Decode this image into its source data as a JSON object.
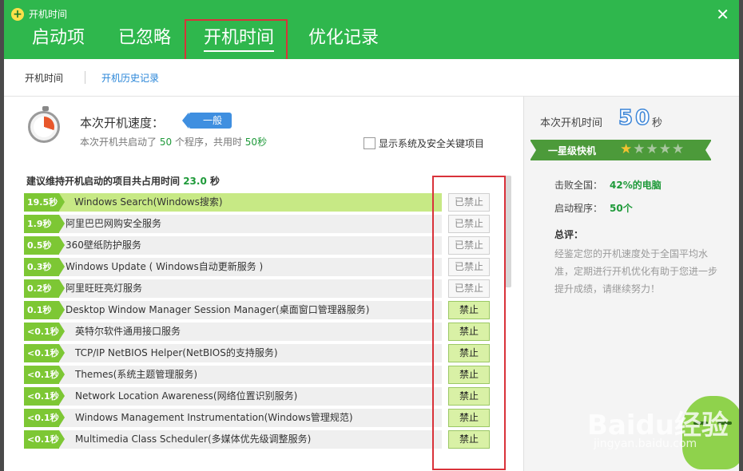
{
  "window": {
    "title": "开机时间",
    "close_symbol": "✕",
    "app_icon_symbol": "+"
  },
  "tabs": [
    {
      "label": "启动项",
      "active": false
    },
    {
      "label": "已忽略",
      "active": false
    },
    {
      "label": "开机时间",
      "active": true
    },
    {
      "label": "优化记录",
      "active": false
    }
  ],
  "subnav": {
    "item1": "开机时间",
    "item2": "开机历史记录"
  },
  "speed": {
    "label": "本次开机速度：",
    "badge": "一般",
    "summary_prefix": "本次开机共启动了",
    "program_count": "50",
    "summary_mid": "个程序，共用时",
    "time_used": "50秒",
    "show_system_label": "显示系统及安全关键项目"
  },
  "advice": {
    "prefix": "建议维持开机启动的项目共占用时间",
    "value": "23.0",
    "unit": "秒"
  },
  "startup_items": [
    {
      "time": "19.5秒",
      "name": "Windows Search(Windows搜索)",
      "action": "已禁止",
      "state": "disabled",
      "indent": 0
    },
    {
      "time": "1.9秒",
      "name": "阿里巴巴网购安全服务",
      "action": "已禁止",
      "state": "disabled",
      "indent": 0
    },
    {
      "time": "0.5秒",
      "name": "360壁纸防护服务",
      "action": "已禁止",
      "state": "disabled",
      "indent": 0
    },
    {
      "time": "0.3秒",
      "name": "Windows Update ( Windows自动更新服务 )",
      "action": "已禁止",
      "state": "disabled",
      "indent": 0
    },
    {
      "time": "0.2秒",
      "name": "阿里旺旺亮灯服务",
      "action": "已禁止",
      "state": "disabled",
      "indent": 0
    },
    {
      "time": "0.1秒",
      "name": "Desktop Window Manager Session Manager(桌面窗口管理器服务)",
      "action": "禁止",
      "state": "enabled",
      "indent": 0
    },
    {
      "time": "<0.1秒",
      "name": "英特尔软件通用接口服务",
      "action": "禁止",
      "state": "enabled",
      "indent": 1
    },
    {
      "time": "<0.1秒",
      "name": "TCP/IP NetBIOS Helper(NetBIOS的支持服务)",
      "action": "禁止",
      "state": "enabled",
      "indent": 1
    },
    {
      "time": "<0.1秒",
      "name": "Themes(系统主题管理服务)",
      "action": "禁止",
      "state": "enabled",
      "indent": 1
    },
    {
      "time": "<0.1秒",
      "name": "Network Location Awareness(网络位置识别服务)",
      "action": "禁止",
      "state": "enabled",
      "indent": 1
    },
    {
      "time": "<0.1秒",
      "name": "Windows Management Instrumentation(Windows管理规范)",
      "action": "禁止",
      "state": "enabled",
      "indent": 1
    },
    {
      "time": "<0.1秒",
      "name": "Multimedia Class Scheduler(多媒体优先级调整服务)",
      "action": "禁止",
      "state": "enabled",
      "indent": 1
    }
  ],
  "right_panel": {
    "boot_time_label": "本次开机时间",
    "boot_time_value": "50",
    "boot_time_unit": "秒",
    "rank_label": "一星级快机",
    "stars_filled": 1,
    "stars_total": 5,
    "beat_label": "击败全国：",
    "beat_value": "42%的电脑",
    "programs_label": "启动程序：",
    "programs_value": "50个",
    "eval_title": "总评：",
    "eval_text": "经鉴定您的开机速度处于全国平均水准，定期进行开机优化有助于您进一步提升成绩，请继续努力！"
  },
  "watermark": {
    "brand": "Baidu经验",
    "url": "jingyan.baidu.com"
  },
  "colors": {
    "header_green": "#2fb74d",
    "time_green": "#7dc734",
    "highlight_red": "#d9323a",
    "badge_blue": "#3f8fe0"
  }
}
